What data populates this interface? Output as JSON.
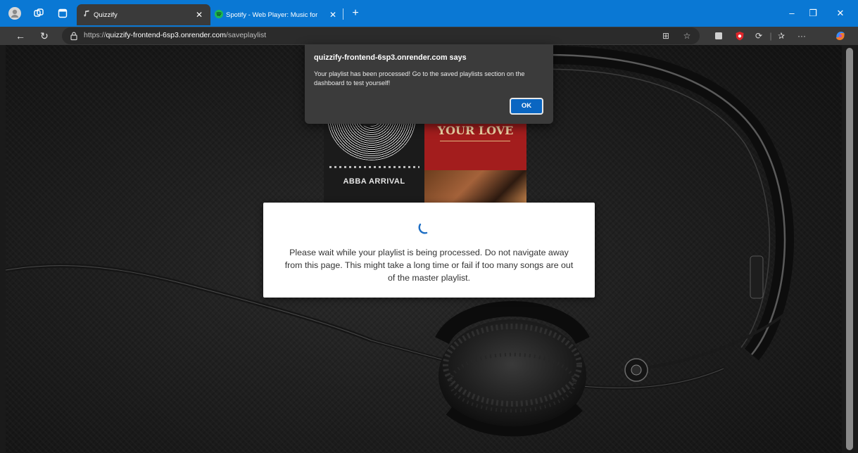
{
  "browser": {
    "tabs": [
      {
        "label": "Quizzify",
        "active": true,
        "favicon": "quizzify-favicon-icon"
      },
      {
        "label": "Spotify - Web Player: Music for e",
        "active": false,
        "favicon": "spotify-favicon-icon"
      }
    ],
    "tab_close_glyph": "✕",
    "new_tab_glyph": "+",
    "window_controls": {
      "minimize": "–",
      "restore": "❐",
      "close": "✕"
    },
    "nav": {
      "back": "←",
      "reload": "↻"
    },
    "address": {
      "scheme": "https://",
      "host": "quizzify-frontend-6sp3.onrender.com",
      "path": "/saveplaylist"
    },
    "accent_color": "#0a78d4"
  },
  "page": {
    "albums": [
      {
        "title": "ABBA ARRIVAL"
      },
      {
        "title": "YOUR LOVE"
      }
    ],
    "loader": {
      "message": "Please wait while your playlist is being processed. Do not navigate away from this page. This might take a long time or fail if too many songs are out of the master playlist."
    }
  },
  "alert": {
    "origin": "quizzify-frontend-6sp3.onrender.com says",
    "message": "Your playlist has been processed! Go to the saved playlists section on the dashboard to test yourself!",
    "ok_label": "OK"
  }
}
